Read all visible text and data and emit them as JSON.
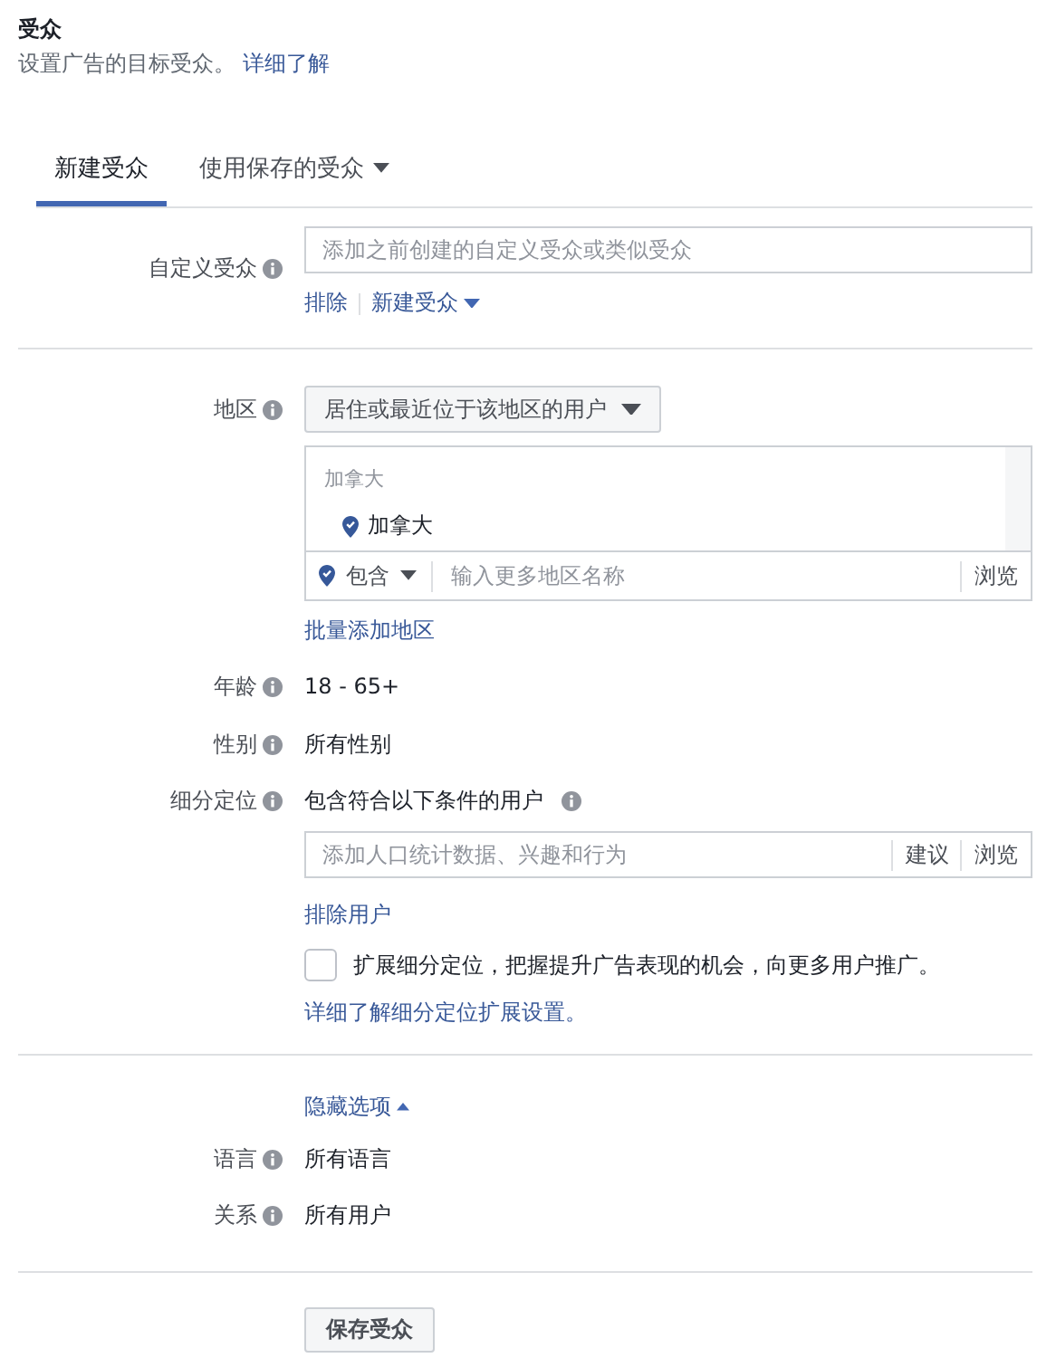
{
  "header": {
    "title": "受众",
    "description": "设置广告的目标受众。",
    "learn_more": "详细了解"
  },
  "tabs": [
    {
      "label": "新建受众",
      "selected": true,
      "dropdown": false
    },
    {
      "label": "使用保存的受众",
      "selected": false,
      "dropdown": true
    }
  ],
  "custom_audience": {
    "label": "自定义受众",
    "placeholder": "添加之前创建的自定义受众或类似受众",
    "links": [
      {
        "label": "排除",
        "dropdown": false
      },
      {
        "label": "新建受众",
        "dropdown": true
      }
    ]
  },
  "location": {
    "label": "地区",
    "select": "居住或最近位于该地区的用户",
    "group_heading": "加拿大",
    "items": [
      "加拿大"
    ],
    "mode": "包含",
    "placeholder": "输入更多地区名称",
    "browse": "浏览",
    "bulk_link": "批量添加地区"
  },
  "rows": [
    {
      "label": "年龄",
      "value": "18 - 65+"
    },
    {
      "label": "性别",
      "value": "所有性别"
    }
  ],
  "detailed_targeting": {
    "label": "细分定位",
    "intro": "包含符合以下条件的用户",
    "placeholder": "添加人口统计数据、兴趣和行为",
    "actions": [
      "建议",
      "浏览"
    ],
    "exclude_link": "排除用户",
    "expansion": {
      "label": "扩展细分定位，把握提升广告表现的机会，向更多用户推广。",
      "checked": false
    },
    "learn_link": "详细了解细分定位扩展设置。"
  },
  "options": {
    "toggle": "隐藏选项",
    "expanded": true,
    "rows": [
      {
        "label": "语言",
        "value": "所有语言"
      },
      {
        "label": "关系",
        "value": "所有用户"
      }
    ]
  },
  "save_button": "保存受众"
}
